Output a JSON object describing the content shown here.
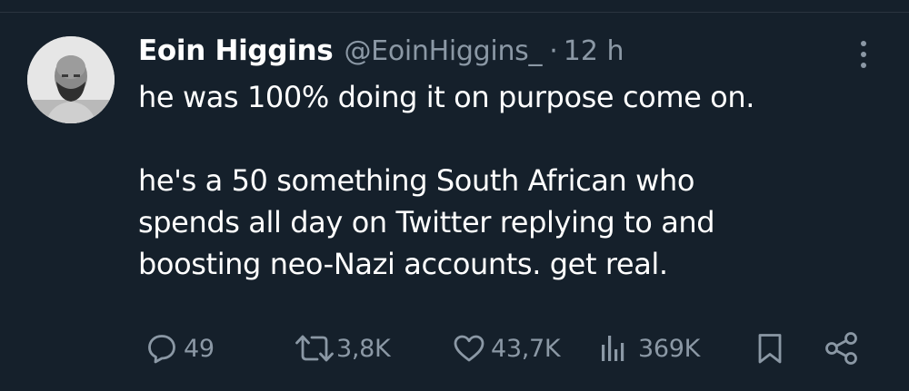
{
  "tweet": {
    "author_name": "Eoin Higgins",
    "author_handle": "@EoinHiggins_",
    "separator": "·",
    "timestamp": "12 h",
    "text_paragraphs": [
      "he was 100% doing it on purpose come on.",
      "he's a 50 something South African who spends all day on Twitter replying to and boosting neo-Nazi accounts. get real."
    ]
  },
  "actions": {
    "replies": "49",
    "reposts": "3,8K",
    "likes": "43,7K",
    "views": "369K"
  },
  "colors": {
    "background": "#15202b",
    "primary_text": "#ffffff",
    "secondary_text": "#8b98a5"
  },
  "icons": [
    "reply-icon",
    "repost-icon",
    "like-icon",
    "views-icon",
    "bookmark-icon",
    "share-icon",
    "more-icon"
  ]
}
